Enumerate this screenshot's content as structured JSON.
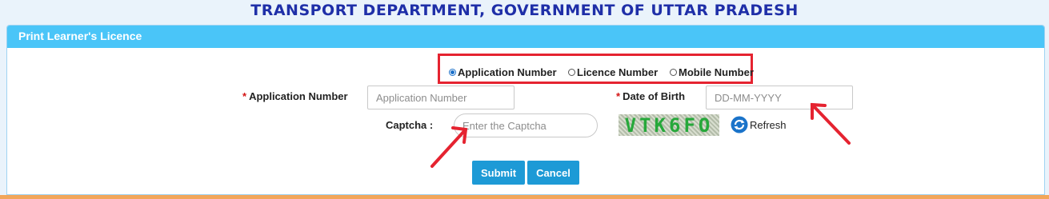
{
  "page": {
    "title": "TRANSPORT DEPARTMENT, GOVERNMENT OF UTTAR PRADESH"
  },
  "panel": {
    "title": "Print Learner's Licence",
    "header_color": "#4ac5f8"
  },
  "search_by": {
    "options": [
      {
        "label": "Application Number",
        "checked": true
      },
      {
        "label": "Licence Number",
        "checked": false
      },
      {
        "label": "Mobile Number",
        "checked": false
      }
    ],
    "highlight_color": "#e52330"
  },
  "form": {
    "required_mark": "*",
    "application_number": {
      "label": "Application Number",
      "placeholder": "Application Number",
      "value": ""
    },
    "dob": {
      "label": "Date of Birth",
      "placeholder": "DD-MM-YYYY",
      "value": ""
    },
    "captcha": {
      "label": "Captcha :",
      "placeholder": "Enter the Captcha",
      "value": "",
      "image_text": "VTK6FO"
    },
    "refresh_label": "Refresh",
    "refresh_icon": "refresh-icon"
  },
  "buttons": {
    "submit": "Submit",
    "cancel": "Cancel",
    "color": "#1d9ad6"
  },
  "annotation_arrows": {
    "color": "#e52330",
    "count": 2
  }
}
